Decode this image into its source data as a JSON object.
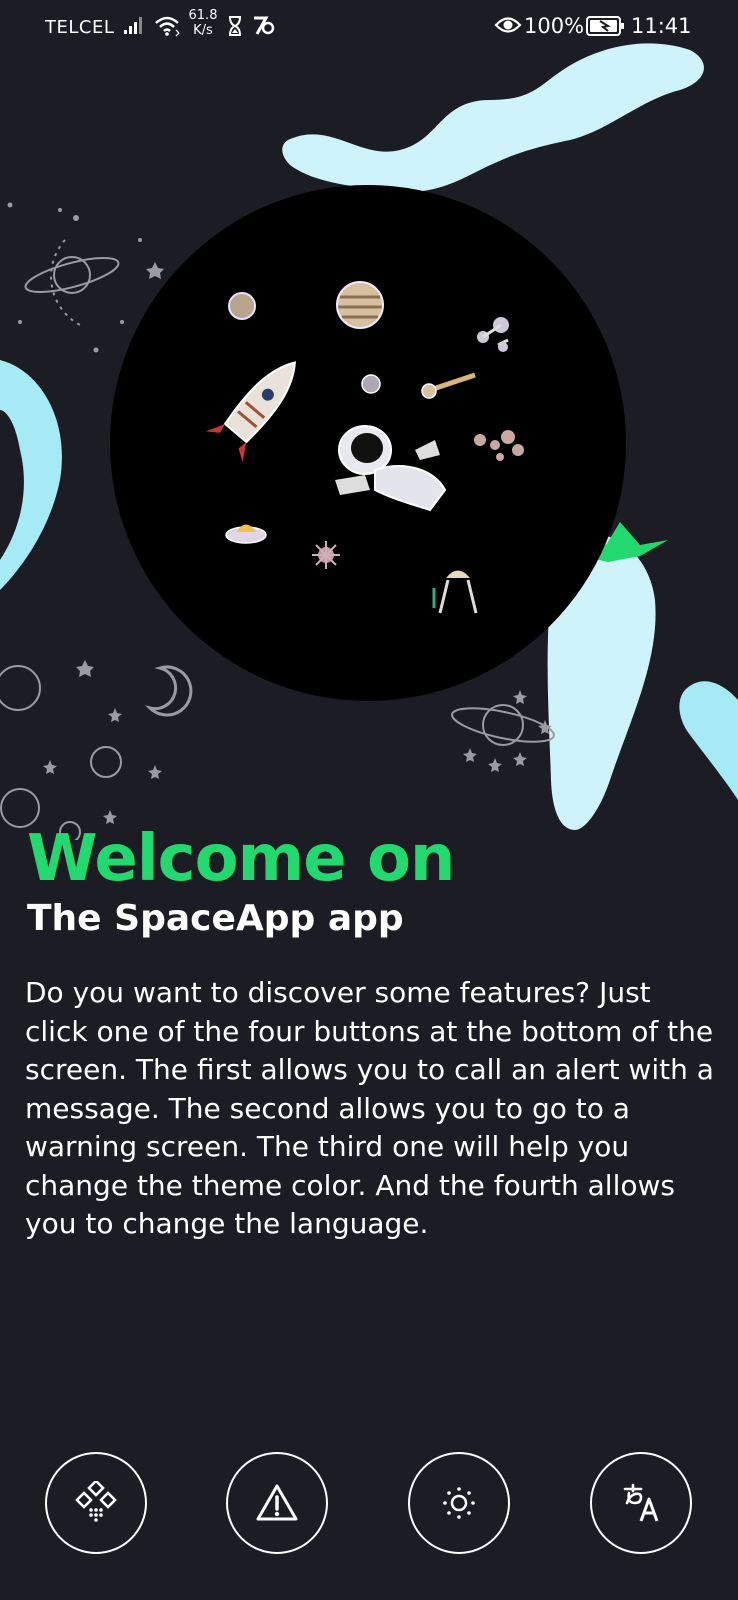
{
  "status_bar": {
    "carrier": "TELCEL",
    "network_speed": "61.8",
    "network_speed_unit": "K/s",
    "battery_percent": "100%",
    "time": "11:41"
  },
  "welcome": {
    "title": "Welcome on",
    "subtitle": "The SpaceApp app",
    "description": "Do you want to discover some features? Just click one of the four buttons at the bottom of the screen. The first allows you to call an alert with a message. The second allows you to go to a warning screen. The third one will help you change the theme color. And the fourth allows you to change the language."
  },
  "bottom_buttons": [
    {
      "name": "alert",
      "icon": "apps-grid-icon"
    },
    {
      "name": "warning",
      "icon": "warning-icon"
    },
    {
      "name": "theme",
      "icon": "brightness-icon"
    },
    {
      "name": "language",
      "icon": "translate-icon"
    }
  ],
  "colors": {
    "background": "#1c1c24",
    "accent": "#22d96f",
    "shape_light": "#cff3fb",
    "shape_cyan": "#a6eaf6"
  }
}
